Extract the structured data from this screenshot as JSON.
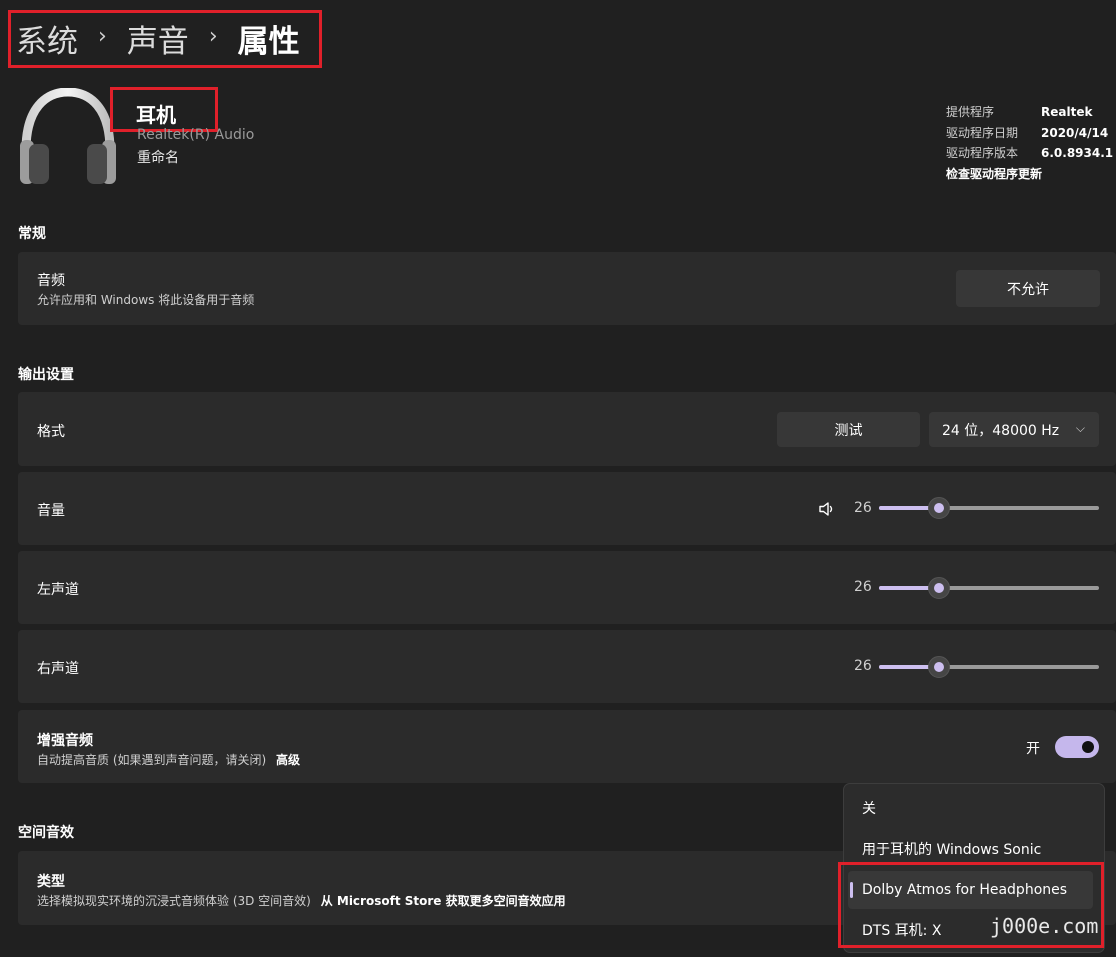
{
  "breadcrumb": {
    "item1": "系统",
    "item2": "声音",
    "item3": "属性",
    "separator": "›"
  },
  "device": {
    "name": "耳机",
    "subtitle": "Realtek(R) Audio",
    "rename": "重命名",
    "icon": "headphones-icon"
  },
  "driver_info": {
    "provider_label": "提供程序",
    "provider_value": "Realtek",
    "date_label": "驱动程序日期",
    "date_value": "2020/4/14",
    "version_label": "驱动程序版本",
    "version_value": "6.0.8934.1",
    "update_link": "检查驱动程序更新"
  },
  "general": {
    "section_title": "常规",
    "audio_title": "音频",
    "audio_desc": "允许应用和 Windows 将此设备用于音频",
    "audio_button": "不允许"
  },
  "output": {
    "section_title": "输出设置",
    "format_title": "格式",
    "test_button": "测试",
    "format_value": "24 位，48000 Hz",
    "volume_title": "音量",
    "volume_value": "26",
    "left_title": "左声道",
    "left_value": "26",
    "right_title": "右声道",
    "right_value": "26",
    "enhance_title": "增强音频",
    "enhance_desc": "自动提高音质 (如果遇到声音问题，请关闭)",
    "enhance_link": "高级",
    "enhance_state": "开"
  },
  "spatial": {
    "section_title": "空间音效",
    "type_title": "类型",
    "type_desc": "选择模拟现实环境的沉浸式音频体验 (3D 空间音效)",
    "type_link": "从 Microsoft Store 获取更多空间音效应用",
    "options": [
      "关",
      "用于耳机的 Windows Sonic",
      "Dolby Atmos for Headphones",
      "DTS 耳机: X"
    ],
    "selected": "Dolby Atmos for Headphones"
  },
  "watermark": "j000e.com",
  "colors": {
    "accent": "#cdbff0",
    "annotation": "#e0202a",
    "background": "#202020",
    "card": "#2b2b2b"
  }
}
